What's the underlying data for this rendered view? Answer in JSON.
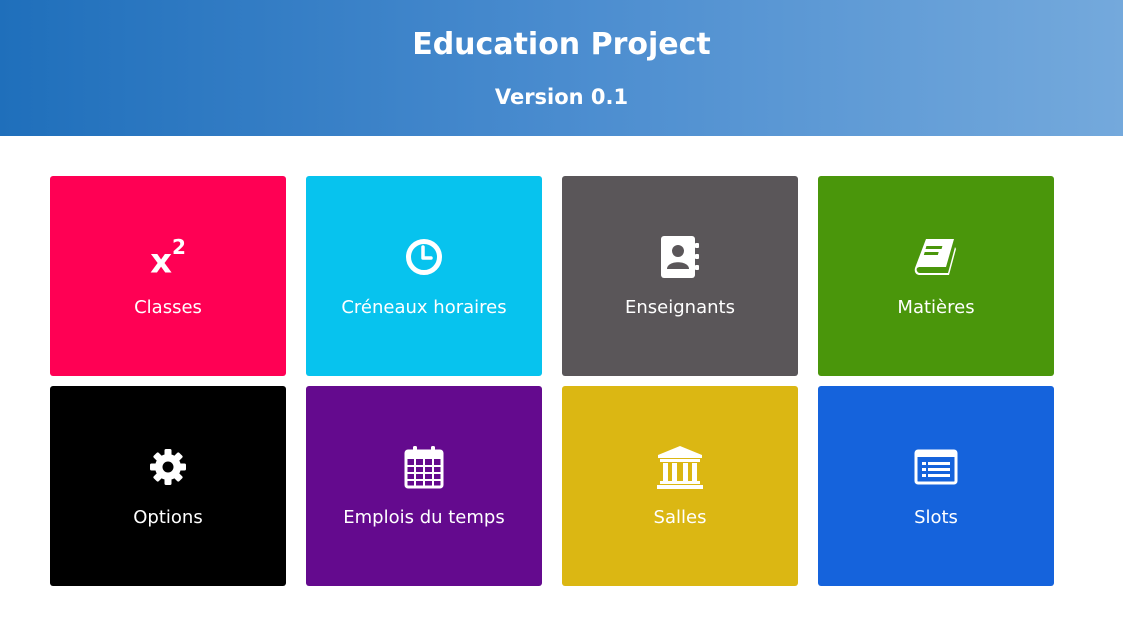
{
  "header": {
    "title": "Education Project",
    "version": "Version 0.1"
  },
  "tiles": [
    {
      "label": "Classes",
      "icon": "superscript-icon",
      "color": "#ff0054"
    },
    {
      "label": "Créneaux horaires",
      "icon": "clock-icon",
      "color": "#07c3ee"
    },
    {
      "label": "Enseignants",
      "icon": "address-book-icon",
      "color": "#5a5659"
    },
    {
      "label": "Matières",
      "icon": "book-icon",
      "color": "#4a960b"
    },
    {
      "label": "Options",
      "icon": "gear-icon",
      "color": "#000000"
    },
    {
      "label": "Emplois du temps",
      "icon": "calendar-icon",
      "color": "#640a8e"
    },
    {
      "label": "Salles",
      "icon": "bank-icon",
      "color": "#dbb713"
    },
    {
      "label": "Slots",
      "icon": "list-icon",
      "color": "#1563dc"
    }
  ],
  "icons": {
    "superscript": {
      "base": "x",
      "exponent": "2"
    }
  }
}
